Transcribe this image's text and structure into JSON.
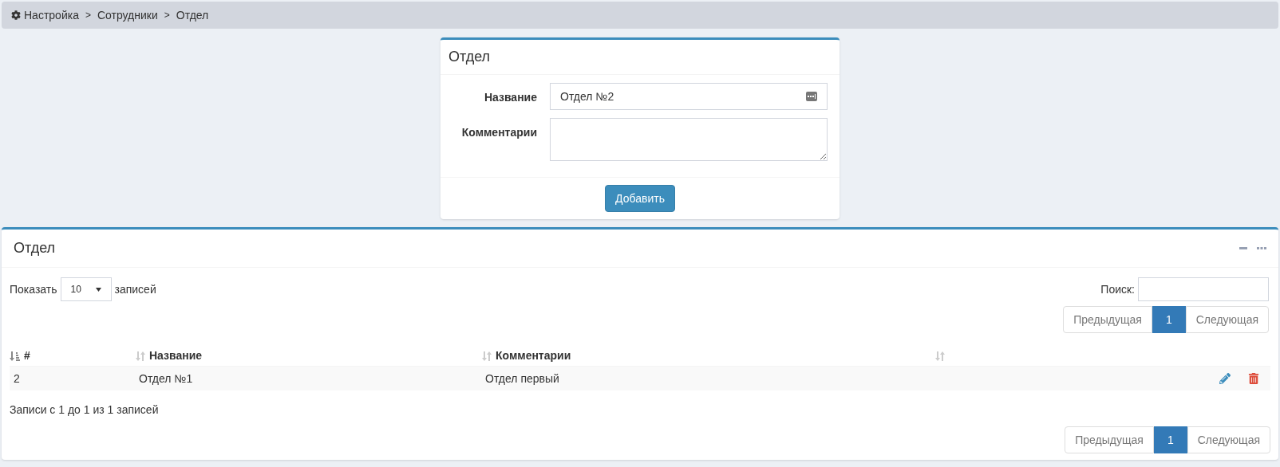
{
  "breadcrumb": [
    "Настройка",
    ">",
    "Сотрудники",
    ">",
    "Отдел"
  ],
  "form": {
    "title": "Отдел",
    "fields": [
      {
        "kind": "input",
        "label": "Название",
        "value": "Отдел №2"
      },
      {
        "kind": "textarea",
        "label": "Комментарии"
      }
    ],
    "submit": "Добавить"
  },
  "panel": {
    "title": "Отдел",
    "length": {
      "before": "Показать",
      "value": "10",
      "after": "записей"
    },
    "search_label": "Поиск:",
    "pagination_top": [
      {
        "label": "Предыдущая",
        "selected": false
      },
      {
        "label": "1",
        "selected": true
      },
      {
        "label": "Следующая",
        "selected": false
      }
    ],
    "table": {
      "columns": [
        {
          "label": "#",
          "sorted": true
        },
        {
          "label": "Название",
          "sorted": false
        },
        {
          "label": "Комментарии",
          "sorted": false
        },
        {
          "sorted": false
        }
      ],
      "rows": [
        {
          "cells": [
            "2",
            "Отдел №1",
            "Отдел первый"
          ]
        }
      ]
    },
    "info": "Записи с 1 до 1 из 1 записей",
    "pagination_bottom": [
      {
        "label": "Предыдущая",
        "selected": false
      },
      {
        "label": "1",
        "selected": true
      },
      {
        "label": "Следующая",
        "selected": false
      }
    ]
  }
}
